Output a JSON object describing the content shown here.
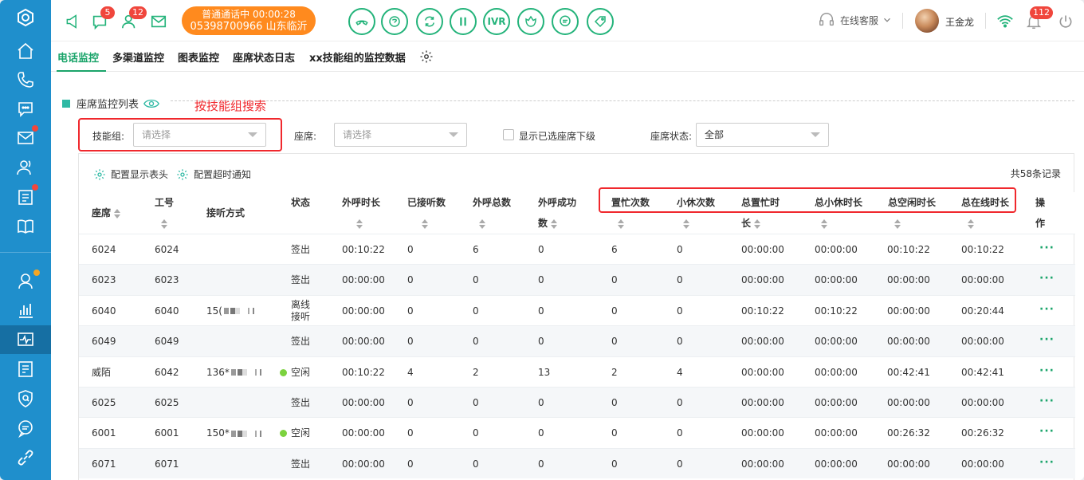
{
  "topbar": {
    "badges": {
      "chat": "5",
      "contacts": "12",
      "notifications": "112"
    },
    "call": {
      "line1": "普通通话中 00:00:28",
      "line2": "05398700966 山东临沂"
    },
    "buttons": {
      "ivr": "IVR"
    },
    "service_label": "在线客服",
    "user_name": "王金龙"
  },
  "tabs": [
    "电话监控",
    "多渠道监控",
    "图表监控",
    "座席状态日志",
    "xx技能组的监控数据"
  ],
  "section": {
    "title": "座席监控列表",
    "note": "按技能组搜索"
  },
  "filters": {
    "skill_label": "技能组:",
    "skill_placeholder": "请选择",
    "agent_label": "座席:",
    "agent_placeholder": "请选择",
    "show_sub_label": "显示已选座席下级",
    "status_label": "座席状态:",
    "status_value": "全部"
  },
  "tools": {
    "config_columns": "配置显示表头",
    "config_timeout": "配置超时通知",
    "total": "共58条记录"
  },
  "columns": {
    "agent": "座席",
    "job_no": "工号",
    "answer_mode": "接听方式",
    "status": "状态",
    "outbound_duration": "外呼时长",
    "answered_count": "已接听数",
    "outbound_total": "外呼总数",
    "outbound_success_1": "外呼成功",
    "outbound_success_2": "数",
    "busy_count": "置忙次数",
    "break_count": "小休次数",
    "total_busy_1": "总置忙时",
    "total_busy_2": "长",
    "total_break": "总小休时长",
    "total_idle": "总空闲时长",
    "total_online": "总在线时长",
    "action_1": "操",
    "action_2": "作"
  },
  "rows": [
    {
      "agent": "6024",
      "job_no": "6024",
      "phone": "",
      "status": "签出",
      "status_line2": "",
      "dot": false,
      "outbound_duration": "00:10:22",
      "answered": "0",
      "outbound_total": "6",
      "outbound_success": "0",
      "busy_count": "6",
      "break_count": "0",
      "total_busy": "00:00:00",
      "total_break": "00:00:00",
      "total_idle": "00:10:22",
      "total_online": "00:10:22",
      "action": "···"
    },
    {
      "agent": "6023",
      "job_no": "6023",
      "phone": "",
      "status": "签出",
      "status_line2": "",
      "dot": false,
      "outbound_duration": "00:00:00",
      "answered": "0",
      "outbound_total": "0",
      "outbound_success": "0",
      "busy_count": "0",
      "break_count": "0",
      "total_busy": "00:00:00",
      "total_break": "00:00:00",
      "total_idle": "00:00:00",
      "total_online": "00:00:00",
      "action": "···"
    },
    {
      "agent": "6040",
      "job_no": "6040",
      "phone": "15(",
      "status": "离线",
      "status_line2": "接听",
      "dot": false,
      "outbound_duration": "00:00:00",
      "answered": "0",
      "outbound_total": "0",
      "outbound_success": "0",
      "busy_count": "0",
      "break_count": "0",
      "total_busy": "00:10:22",
      "total_break": "00:10:22",
      "total_idle": "00:00:00",
      "total_online": "00:20:44",
      "action": "···"
    },
    {
      "agent": "6049",
      "job_no": "6049",
      "phone": "",
      "status": "签出",
      "status_line2": "",
      "dot": false,
      "outbound_duration": "00:00:00",
      "answered": "0",
      "outbound_total": "0",
      "outbound_success": "0",
      "busy_count": "0",
      "break_count": "0",
      "total_busy": "00:00:00",
      "total_break": "00:00:00",
      "total_idle": "00:00:00",
      "total_online": "00:00:00",
      "action": "···"
    },
    {
      "agent": "威陌",
      "job_no": "6042",
      "phone": "136*",
      "status": "空闲",
      "status_line2": "",
      "dot": true,
      "outbound_duration": "00:10:22",
      "answered": "4",
      "outbound_total": "2",
      "outbound_success": "13",
      "busy_count": "2",
      "break_count": "4",
      "total_busy": "00:00:00",
      "total_break": "00:00:00",
      "total_idle": "00:42:41",
      "total_online": "00:42:41",
      "action": "···"
    },
    {
      "agent": "6025",
      "job_no": "6025",
      "phone": "",
      "status": "签出",
      "status_line2": "",
      "dot": false,
      "outbound_duration": "00:00:00",
      "answered": "0",
      "outbound_total": "0",
      "outbound_success": "0",
      "busy_count": "0",
      "break_count": "0",
      "total_busy": "00:00:00",
      "total_break": "00:00:00",
      "total_idle": "00:00:00",
      "total_online": "00:00:00",
      "action": "···"
    },
    {
      "agent": "6001",
      "job_no": "6001",
      "phone": "150*",
      "status": "空闲",
      "status_line2": "",
      "dot": true,
      "outbound_duration": "00:00:00",
      "answered": "0",
      "outbound_total": "0",
      "outbound_success": "0",
      "busy_count": "0",
      "break_count": "0",
      "total_busy": "00:00:00",
      "total_break": "00:00:00",
      "total_idle": "00:26:32",
      "total_online": "00:26:32",
      "action": "···"
    },
    {
      "agent": "6071",
      "job_no": "6071",
      "phone": "",
      "status": "签出",
      "status_line2": "",
      "dot": false,
      "outbound_duration": "00:00:00",
      "answered": "0",
      "outbound_total": "0",
      "outbound_success": "0",
      "busy_count": "0",
      "break_count": "0",
      "total_busy": "00:00:00",
      "total_break": "00:00:00",
      "total_idle": "00:00:00",
      "total_online": "00:00:00",
      "action": "···"
    }
  ],
  "colors": {
    "sidebar": "#1f8fcc",
    "accent_green": "#1aa46a",
    "call_orange": "#ff8a1e",
    "annotation_red": "#f0282d",
    "status_idle": "#7cd23f"
  }
}
